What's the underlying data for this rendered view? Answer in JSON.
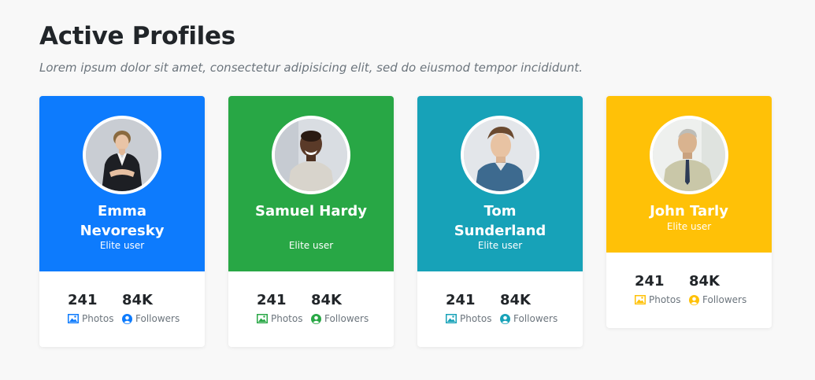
{
  "header": {
    "title": "Active Profiles",
    "subtitle": "Lorem ipsum dolor sit amet, consectetur adipisicing elit, sed do eiusmod tempor incididunt."
  },
  "profiles": [
    {
      "name": "Emma Nevoresky",
      "role": "Elite user",
      "color": "#0d7bfd",
      "photos_count": "241",
      "photos_label": "Photos",
      "followers_count": "84K",
      "followers_label": "Followers",
      "avatar_icon": "avatar-woman-blazer"
    },
    {
      "name": "Samuel Hardy",
      "role": "Elite user",
      "color": "#28a745",
      "photos_count": "241",
      "photos_label": "Photos",
      "followers_count": "84K",
      "followers_label": "Followers",
      "avatar_icon": "avatar-man-smiling"
    },
    {
      "name": "Tom Sunderland",
      "role": "Elite user",
      "color": "#17a2b8",
      "photos_count": "241",
      "photos_label": "Photos",
      "followers_count": "84K",
      "followers_label": "Followers",
      "avatar_icon": "avatar-young-man"
    },
    {
      "name": "John Tarly",
      "role": "Elite user",
      "color": "#ffc107",
      "photos_count": "241",
      "photos_label": "Photos",
      "followers_count": "84K",
      "followers_label": "Followers",
      "avatar_icon": "avatar-older-man"
    }
  ]
}
